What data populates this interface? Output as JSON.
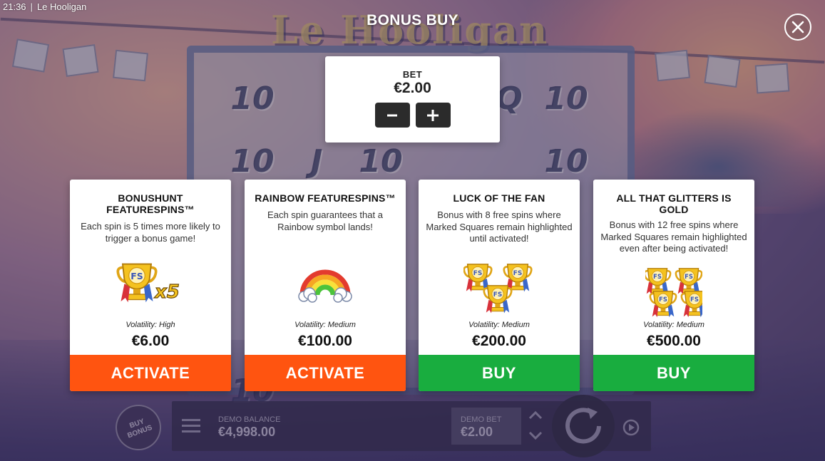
{
  "status_bar": {
    "time": "21:36",
    "separator": "|",
    "app_title": "Le Hooligan"
  },
  "backdrop": {
    "logo_text": "Le Hooligan",
    "reel_symbols": [
      "10",
      "10",
      "10",
      "J",
      "10",
      "Q",
      "10",
      "10"
    ]
  },
  "dialog": {
    "title": "BONUS BUY",
    "close_icon": "close-icon",
    "bet": {
      "label": "BET",
      "value": "€2.00",
      "decrease_icon": "minus-icon",
      "increase_icon": "plus-icon"
    }
  },
  "cards": [
    {
      "title": "BONUSHUNT FEATURESPINS™",
      "description": "Each spin is 5 times more likely to trigger a bonus game!",
      "art_icon": "trophy-x5-icon",
      "art_text": "x5",
      "volatility": "Volatility: High",
      "price": "€6.00",
      "button_label": "ACTIVATE",
      "button_color": "#ff5410"
    },
    {
      "title": "RAINBOW FEATURESPINS™",
      "description": "Each spin guarantees that a Rainbow symbol lands!",
      "art_icon": "rainbow-icon",
      "volatility": "Volatility: Medium",
      "price": "€100.00",
      "button_label": "ACTIVATE",
      "button_color": "#ff5410"
    },
    {
      "title": "LUCK OF THE FAN",
      "description": "Bonus with 8 free spins where Marked Squares remain highlighted until activated!",
      "art_icon": "three-trophies-icon",
      "volatility": "Volatility: Medium",
      "price": "€200.00",
      "button_label": "BUY",
      "button_color": "#19ad3f"
    },
    {
      "title": "ALL THAT GLITTERS IS GOLD",
      "description": "Bonus with 12 free spins where Marked Squares remain highlighted even after being activated!",
      "art_icon": "four-trophies-icon",
      "volatility": "Volatility: Medium",
      "price": "€500.00",
      "button_label": "BUY",
      "button_color": "#19ad3f"
    }
  ],
  "bottom_bar": {
    "buy_bonus_line1": "BUY",
    "buy_bonus_line2": "BONUS",
    "balance_label": "DEMO BALANCE",
    "balance_value": "€4,998.00",
    "bet_label": "DEMO BET",
    "bet_value": "€2.00"
  }
}
